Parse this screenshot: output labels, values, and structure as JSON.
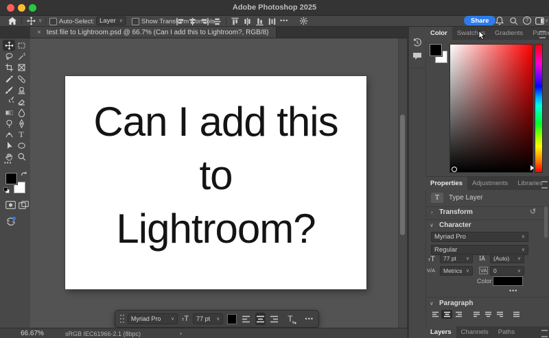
{
  "window": {
    "title": "Adobe Photoshop 2025"
  },
  "options_bar": {
    "auto_select_label": "Auto-Select:",
    "auto_select_value": "Layer",
    "show_transform_label": "Show Transform Controls",
    "share_label": "Share"
  },
  "document_tab": {
    "close_glyph": "×",
    "title": "test file to Lightroom.psd @ 66.7% (Can I add this to Lightroom?, RGB/8)"
  },
  "canvas": {
    "lines": [
      "Can I add this",
      "to",
      "Lightroom?"
    ]
  },
  "text_options_bar": {
    "font": "Myriad Pro",
    "size": "77 pt"
  },
  "status_bar": {
    "zoom": "66.67%",
    "color_profile": "sRGB IEC61966-2.1 (8bpc)",
    "chevron": "›"
  },
  "right_dock": {
    "color_panel": {
      "tabs": [
        "Color",
        "Swatches",
        "Gradients",
        "Patterns"
      ],
      "active_tab": "Color"
    },
    "properties_panel": {
      "tabs": [
        "Properties",
        "Adjustments",
        "Libraries"
      ],
      "active_tab": "Properties",
      "layer_type_icon": "T",
      "layer_type_label": "Type Layer",
      "transform_label": "Transform",
      "character_label": "Character",
      "character": {
        "font": "Myriad Pro",
        "style": "Regular",
        "size": "77 pt",
        "leading": "(Auto)",
        "kerning": "Metrics",
        "tracking": "0",
        "color_label": "Color"
      },
      "paragraph_label": "Paragraph"
    },
    "bottom_tabs": {
      "tabs": [
        "Layers",
        "Channels",
        "Paths"
      ],
      "active_tab": "Layers"
    }
  },
  "tools": [
    "move",
    "rectangular-marquee",
    "lasso",
    "object-selection",
    "crop",
    "frame",
    "eyedropper",
    "spot-healing-brush",
    "brush",
    "clone-stamp",
    "history-brush",
    "eraser",
    "gradient",
    "blur",
    "dodge",
    "pen",
    "curvature-pen",
    "type",
    "path-selection",
    "shape",
    "hand",
    "zoom"
  ],
  "colors": {
    "accent_blue": "#2e7ceb",
    "pasteboard": "#535353",
    "panel_bg": "#474747",
    "foreground": "#000000",
    "background_swatch": "#ffffff",
    "hue_selected": "#ff0000"
  },
  "glyphs": {
    "chevron_down": "∨",
    "collapsed": "›",
    "expanded": "∨",
    "ellipsis": "•••",
    "reset": "↺",
    "size_icon": "T",
    "size_icon_small": "т",
    "kerning_icon": "V/A",
    "tracking_icon": "VA",
    "help": "?",
    "type_tool": "T"
  }
}
